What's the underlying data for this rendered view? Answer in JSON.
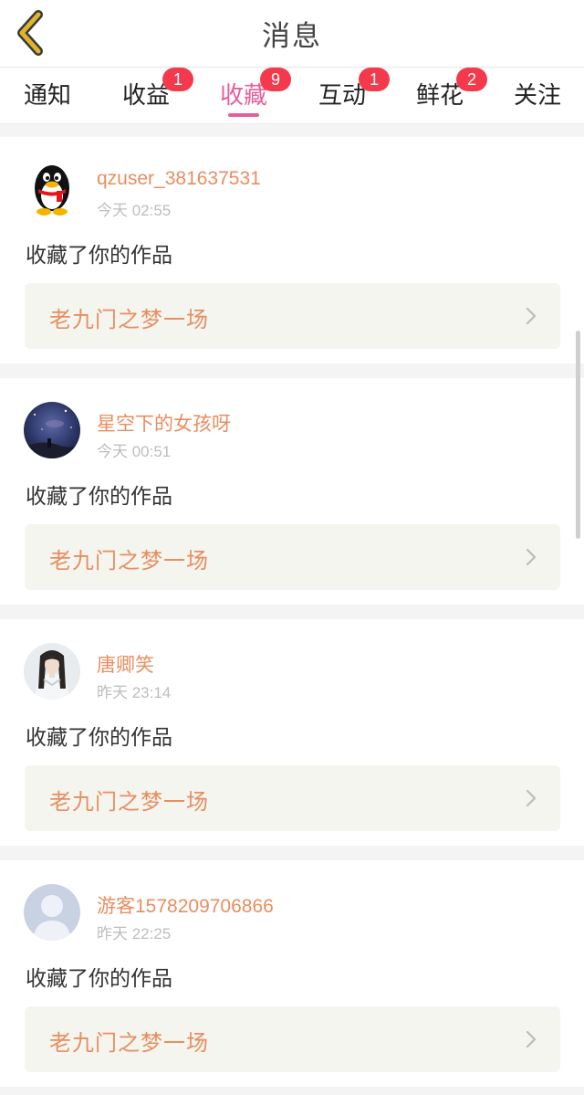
{
  "header": {
    "title": "消息",
    "back_icon": "chevron-left-icon",
    "back_color": "#e0b52a"
  },
  "tabs": [
    {
      "label": "通知",
      "badge": ""
    },
    {
      "label": "收益",
      "badge": "1"
    },
    {
      "label": "收藏",
      "badge": "9",
      "active": true
    },
    {
      "label": "互动",
      "badge": "1"
    },
    {
      "label": "鲜花",
      "badge": "2"
    },
    {
      "label": "关注",
      "badge": ""
    }
  ],
  "colors": {
    "accent": "#e95d9a",
    "badge": "#f23a4c",
    "username": "#e88e61",
    "work_title": "#e88e61"
  },
  "notifications": [
    {
      "username": "qzuser_381637531",
      "time": "今天 02:55",
      "action": "收藏了你的作品",
      "work": "老九门之梦一场",
      "avatar": "qq-penguin-avatar"
    },
    {
      "username": "星空下的女孩呀",
      "time": "今天 00:51",
      "action": "收藏了你的作品",
      "work": "老九门之梦一场",
      "avatar": "starry-sky-avatar"
    },
    {
      "username": "唐卿笑",
      "time": "昨天 23:14",
      "action": "收藏了你的作品",
      "work": "老九门之梦一场",
      "avatar": "costume-portrait-avatar"
    },
    {
      "username": "游客1578209706866",
      "time": "昨天 22:25",
      "action": "收藏了你的作品",
      "work": "老九门之梦一场",
      "avatar": "default-user-avatar"
    }
  ]
}
